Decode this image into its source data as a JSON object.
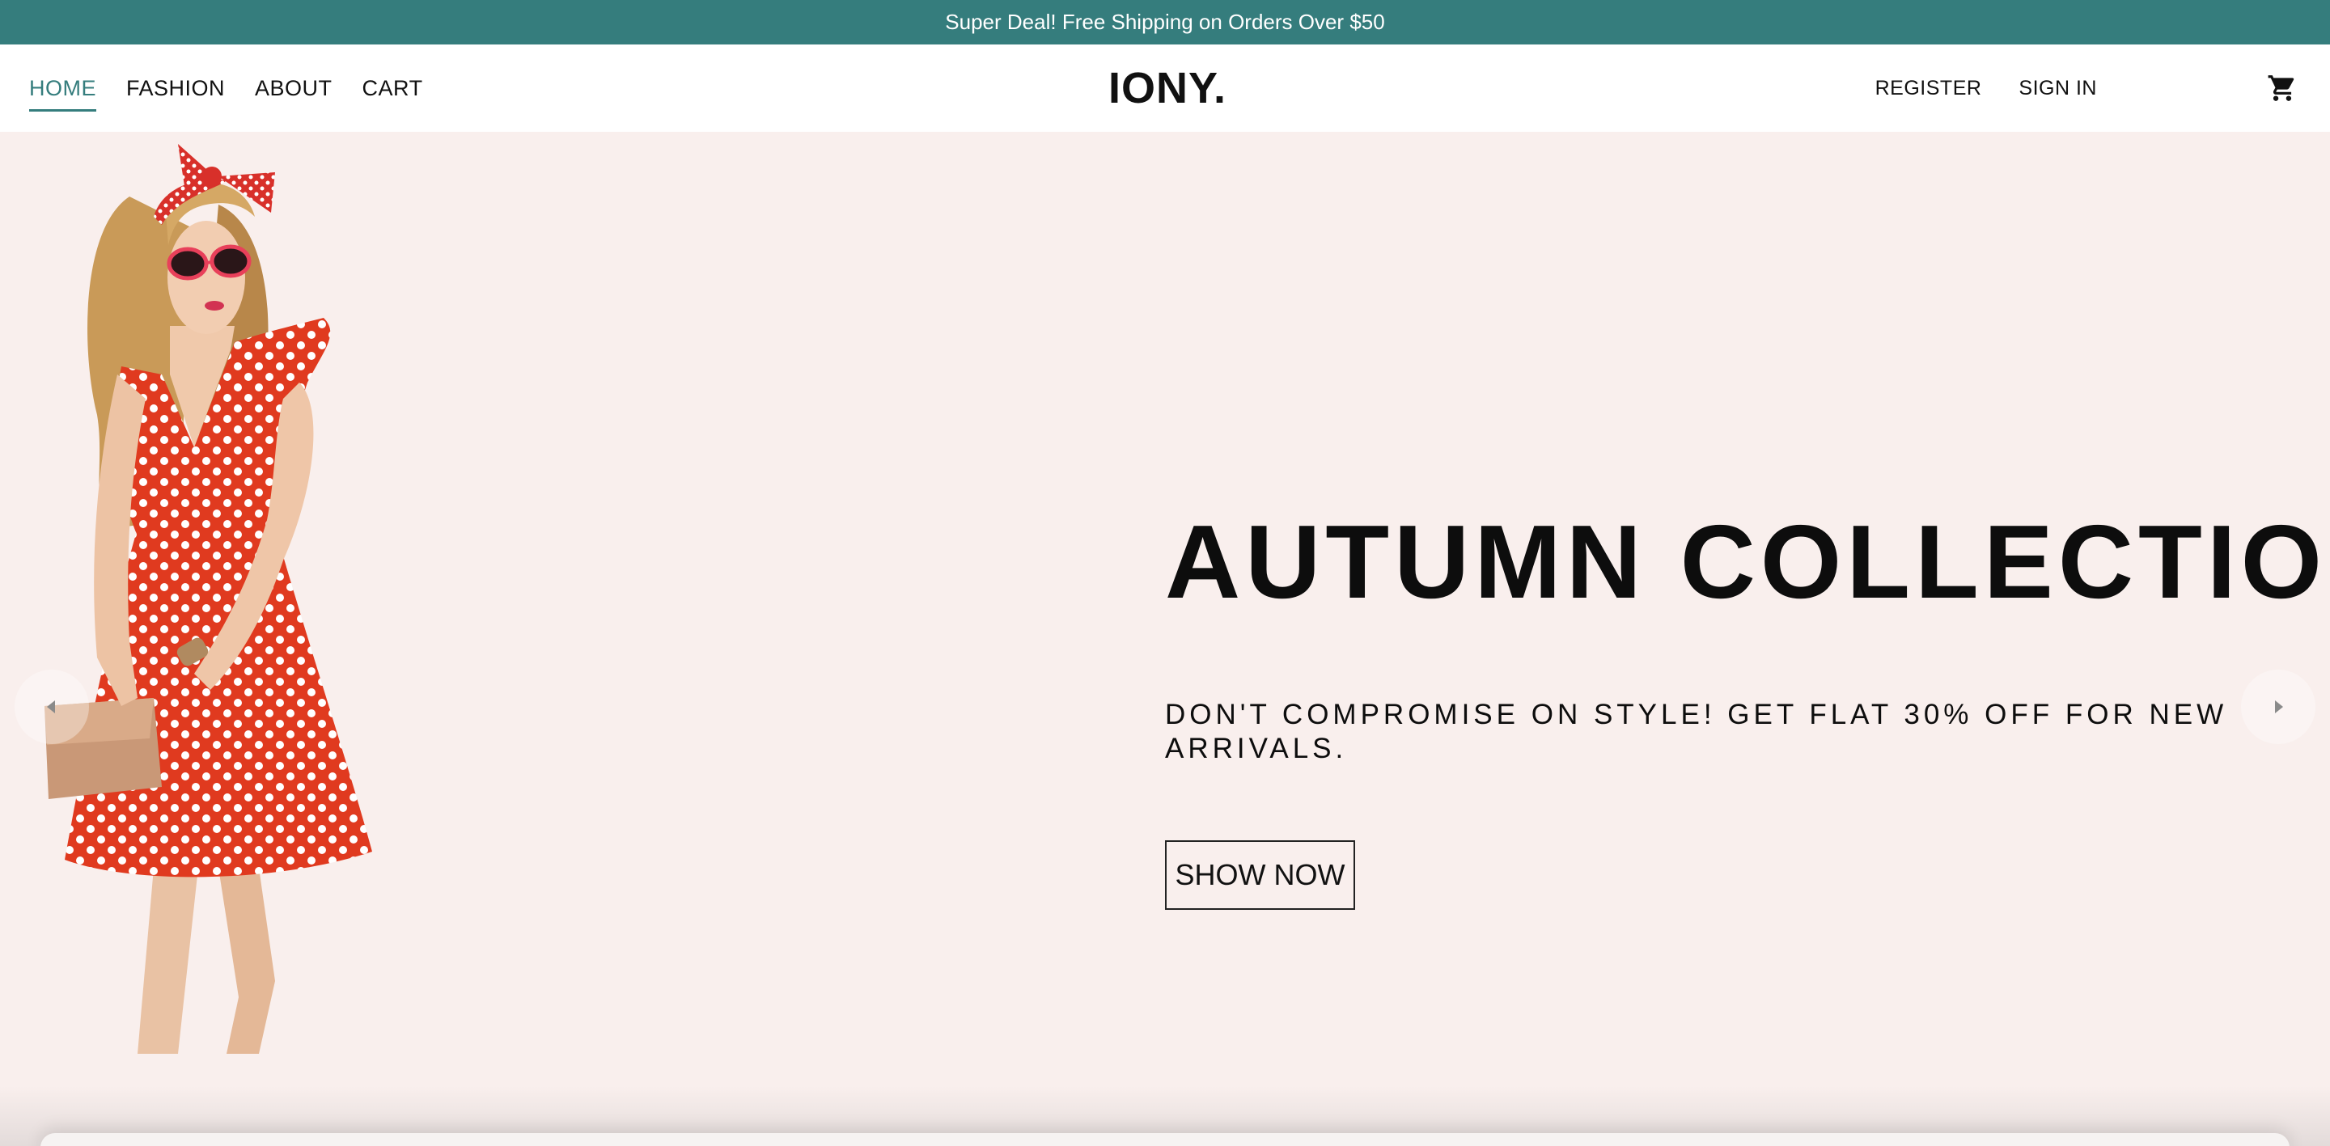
{
  "announcement": "Super Deal! Free Shipping on Orders Over $50",
  "nav": {
    "left": [
      {
        "label": "HOME",
        "active": true
      },
      {
        "label": "FASHION",
        "active": false
      },
      {
        "label": "ABOUT",
        "active": false
      },
      {
        "label": "CART",
        "active": false
      }
    ],
    "logo": "IONY.",
    "right": [
      {
        "label": "REGISTER"
      },
      {
        "label": "SIGN IN"
      }
    ],
    "cart_icon": "shopping-cart-icon"
  },
  "hero": {
    "title": "AUTUMN COLLECTION",
    "subtitle": "DON'T COMPROMISE ON STYLE! GET FLAT 30% OFF FOR NEW ARRIVALS.",
    "button": "SHOW NOW",
    "image": "model-red-polka-dot-dress",
    "prev_icon": "chevron-left-icon",
    "next_icon": "chevron-right-icon"
  },
  "colors": {
    "accent": "#357d7d",
    "hero_bg": "#f9efed",
    "dress": "#e03a1f"
  }
}
